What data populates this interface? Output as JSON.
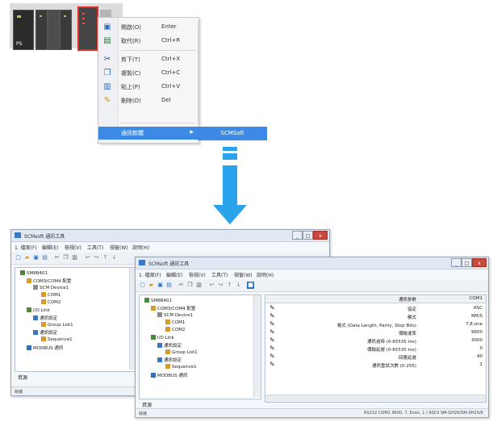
{
  "rack": {
    "ps_label": "PS"
  },
  "context_menu": {
    "items": [
      {
        "label": "開啟(O)",
        "shortcut": "Enter",
        "icon": "open-icon"
      },
      {
        "label": "取代(R)",
        "shortcut": "Ctrl+R",
        "icon": "replace-icon"
      },
      {
        "label": "剪下(T)",
        "shortcut": "Ctrl+X",
        "icon": "scissors-icon"
      },
      {
        "label": "複製(C)",
        "shortcut": "Ctrl+C",
        "icon": "copy-icon"
      },
      {
        "label": "貼上(P)",
        "shortcut": "Ctrl+V",
        "icon": "paste-icon"
      },
      {
        "label": "刪除(D)",
        "shortcut": "Del",
        "icon": "eraser-icon"
      }
    ],
    "highlighted": {
      "label": "通訊軟體"
    },
    "submenu_item": "SCMSoft"
  },
  "window_back": {
    "title": "SCMsoft 通訊工具",
    "menubar": [
      "1. 檔案(F)",
      "編輯(E)",
      "檢視(V)",
      "工具(T)",
      "視窗(W)",
      "說明(H)"
    ],
    "tree": [
      "SM8B401",
      "COM3/COM4 配置",
      "SCM Device1",
      "COM1",
      "COM2",
      "I/O Link",
      "通訊設定",
      "Group List1",
      "通訊設定",
      "Sequence1",
      "MODBUS 通訊"
    ],
    "tab": "資源",
    "status": "就緒"
  },
  "window_front": {
    "title": "SCMsoft 通訊工具",
    "menubar": [
      "1. 檔案(F)",
      "編輯(E)",
      "檢視(V)",
      "工具(T)",
      "視窗(W)",
      "說明(H)"
    ],
    "tree": [
      "SM8B401",
      "COM3/COM4 配置",
      "SCM Device1",
      "COM1",
      "COM2",
      "I/O Link",
      "通訊設定",
      "Group List1",
      "通訊設定",
      "Sequence1",
      "MODBUS 通訊"
    ],
    "grid_header_name": "通訊參數",
    "grid_header_value": "COM1",
    "rows": [
      {
        "name": "協定",
        "value": "ASC"
      },
      {
        "name": "模式",
        "value": "RM/S"
      },
      {
        "name": "格式 (Data Length, Parity, Stop Bits)",
        "value": "7,E,one"
      },
      {
        "name": "傳輸速率",
        "value": "9600"
      },
      {
        "name": "通訊逾時 (0-65535 ms)",
        "value": "3000"
      },
      {
        "name": "傳輸延遲 (0-65535 ms)",
        "value": "0"
      },
      {
        "name": "回應延遲",
        "value": "40"
      },
      {
        "name": "通訊重試次數 (0-255)",
        "value": "1"
      }
    ],
    "tab": "資源",
    "status": "就緒",
    "status_right": "RS232 COM1 9600, 7, Even, 1 / ASCII  SM-GH2K/SM-SH2X/K"
  }
}
